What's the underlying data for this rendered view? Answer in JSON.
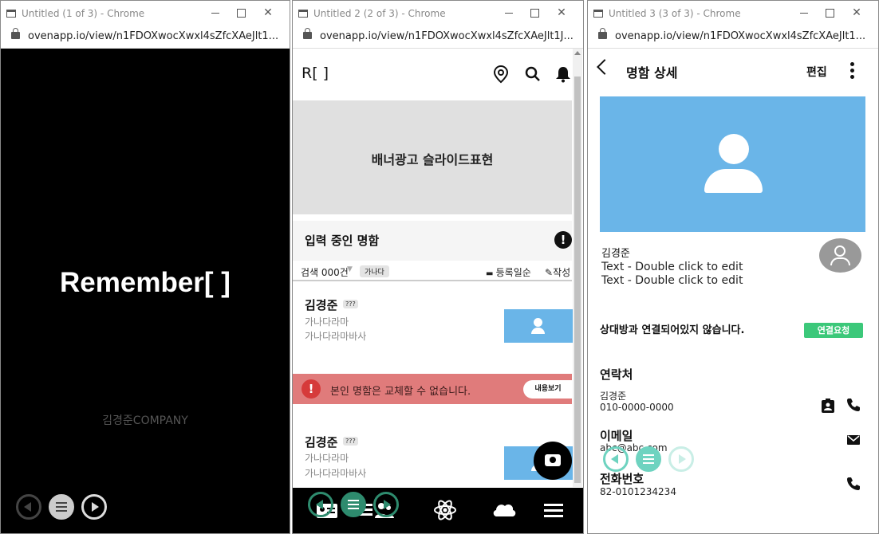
{
  "windows": [
    {
      "title": "Untitled (1 of 3) - Chrome",
      "url": "ovenapp.io/view/n1FDOXwocXwxl4sZfcXAeJlt1..."
    },
    {
      "title": "Untitled 2 (2 of 3) - Chrome",
      "url": "ovenapp.io/view/n1FDOXwocXwxl4sZfcXAeJlt1J..."
    },
    {
      "title": "Untitled 3 (3 of 3) - Chrome",
      "url": "ovenapp.io/view/n1FDOXwocXwxl4sZfcXAeJlt1..."
    }
  ],
  "splash": {
    "title": "Remember[ ]",
    "company": "김경준COMPANY"
  },
  "home": {
    "logo": "R[ ]",
    "banner": "배너광고 슬라이드표현",
    "section_title": "입력 중인 명함",
    "filter": {
      "count": "검색 000건",
      "chip": "가나다",
      "sort": "등록일순",
      "write": "작성"
    },
    "cards": [
      {
        "name": "김경준",
        "badge": "???",
        "line1": "가나다라마",
        "line2": "가나다라마바사"
      },
      {
        "name": "김경준",
        "badge": "???",
        "line1": "가나다라마",
        "line2": "가나다라마바사"
      }
    ],
    "toast": {
      "message": "본인 명함은 교체할 수 없습니다.",
      "button": "내용보기"
    }
  },
  "detail": {
    "title": "명함 상세",
    "edit": "편집",
    "name": "김경준",
    "text1": "Text - Double click to edit",
    "text2": "Text - Double click to edit",
    "status": "상대방과 연결되어있지 않습니다.",
    "connect_button": "연결요청",
    "contact_title": "연락처",
    "contact_name": "김경준",
    "contact_phone": "010-0000-0000",
    "email_title": "이메일",
    "email": "abc@abc.com",
    "phone_title": "전화번호",
    "phone": "82-0101234234"
  },
  "colors": {
    "accent_blue": "#6ab5e8",
    "toast_red": "#e07b7b",
    "connect_green": "#3cc87a",
    "nav_teal": "#6ed3c0"
  }
}
